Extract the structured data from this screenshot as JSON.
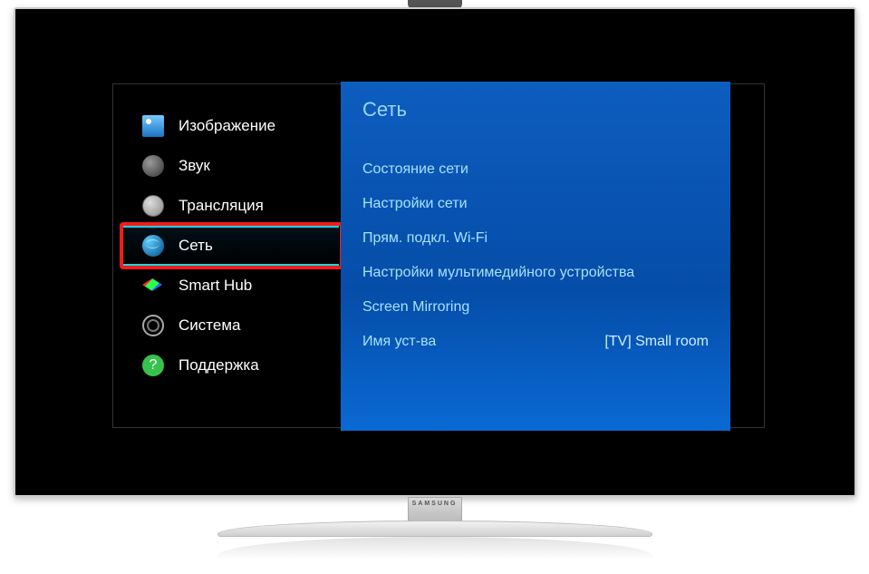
{
  "brand": "SAMSUNG",
  "sidebar": {
    "items": [
      {
        "label": "Изображение",
        "icon": "picture-icon"
      },
      {
        "label": "Звук",
        "icon": "sound-icon"
      },
      {
        "label": "Трансляция",
        "icon": "broadcast-icon"
      },
      {
        "label": "Сеть",
        "icon": "network-icon",
        "selected": true,
        "highlighted": true
      },
      {
        "label": "Smart Hub",
        "icon": "smarthub-icon"
      },
      {
        "label": "Система",
        "icon": "system-icon"
      },
      {
        "label": "Поддержка",
        "icon": "support-icon"
      }
    ]
  },
  "panel": {
    "title": "Сеть",
    "items": [
      {
        "label": "Состояние сети"
      },
      {
        "label": "Настройки сети"
      },
      {
        "label": "Прям. подкл. Wi-Fi"
      },
      {
        "label": "Настройки мультимедийного устройства"
      },
      {
        "label": "Screen Mirroring"
      },
      {
        "label": "Имя уст-ва",
        "value": "[TV] Small room"
      }
    ]
  }
}
